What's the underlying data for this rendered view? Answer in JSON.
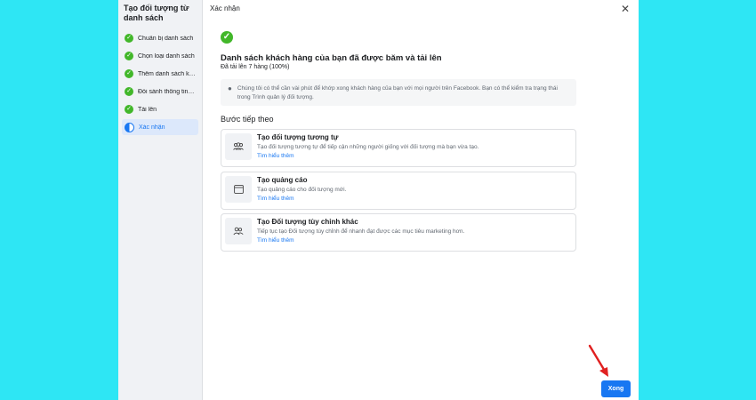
{
  "sidebar": {
    "title": "Tạo đối tượng từ danh sách",
    "items": [
      {
        "label": "Chuẩn bị danh sách",
        "state": "done"
      },
      {
        "label": "Chọn loại danh sách",
        "state": "done"
      },
      {
        "label": "Thêm danh sách kh...",
        "state": "done"
      },
      {
        "label": "Đối sánh thông tin n...",
        "state": "done"
      },
      {
        "label": "Tải lên",
        "state": "done"
      },
      {
        "label": "Xác nhận",
        "state": "active"
      }
    ]
  },
  "header": {
    "title": "Xác nhận",
    "close_glyph": "✕"
  },
  "success": {
    "title": "Danh sách khách hàng của bạn đã được băm và tải lên",
    "subtitle": "Đã tải lên 7 hàng (100%)"
  },
  "note": {
    "text": "Chúng tôi có thể cần vài phút để khớp xong khách hàng của bạn với mọi người trên Facebook. Bạn có thể kiểm tra trạng thái trong Trình quản lý đối tượng."
  },
  "next_steps": {
    "title": "Bước tiếp theo",
    "cards": [
      {
        "icon": "people-group-icon",
        "title": "Tạo đối tượng tương tự",
        "desc": "Tạo đối tượng tương tự để tiếp cận những người giống với đối tượng mà bạn vừa tạo.",
        "link": "Tìm hiểu thêm"
      },
      {
        "icon": "ad-window-icon",
        "title": "Tạo quảng cáo",
        "desc": "Tạo quảng cáo cho đối tượng mới.",
        "link": "Tìm hiểu thêm"
      },
      {
        "icon": "people-icon",
        "title": "Tạo Đối tượng tùy chỉnh khác",
        "desc": "Tiếp tục tạo Đối tượng tùy chỉnh để nhanh đạt được các mục tiêu marketing hơn.",
        "link": "Tìm hiểu thêm"
      }
    ]
  },
  "footer": {
    "done_label": "Xong"
  },
  "colors": {
    "background": "#2ee6f4",
    "accent": "#1877f2",
    "success": "#42b72a",
    "arrow": "#e02020"
  }
}
